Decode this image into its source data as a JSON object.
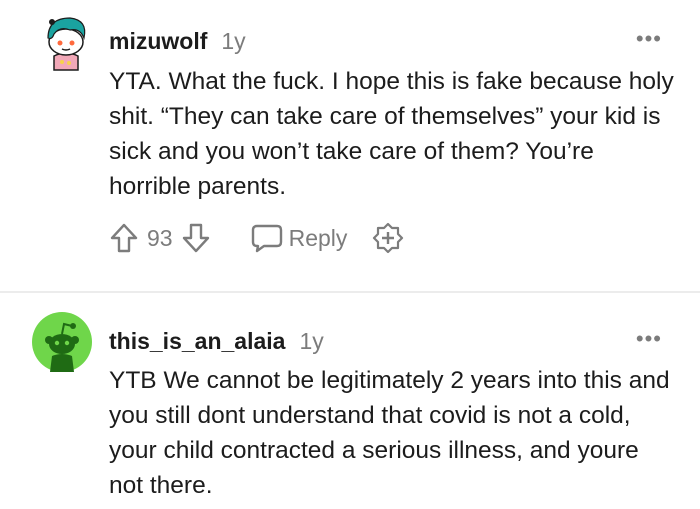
{
  "comments": [
    {
      "username": "mizuwolf",
      "age": "1y",
      "more_label": "•••",
      "body": "YTA. What the fuck. I hope this is fake because holy shit. “They can take care of themselves” your kid is sick and you won’t take care of them? You’re horrible parents.",
      "score": "93",
      "reply_label": "Reply",
      "avatar_icon": "snoo-teal-hair-avatar-icon"
    },
    {
      "username": "this_is_an_alaia",
      "age": "1y",
      "more_label": "•••",
      "body": "YTB We cannot be legitimately 2 years into this and you still dont understand that covid is not a cold, your child contracted a serious illness, and youre not there.",
      "avatar_icon": "default-snoo-avatar-icon"
    }
  ],
  "colors": {
    "text": "#1c1c1c",
    "meta": "#7c7c7c",
    "avatar_bg_green": "#6fd64a",
    "avatar_hair_teal": "#1aa3a0",
    "divider": "#ececec"
  }
}
